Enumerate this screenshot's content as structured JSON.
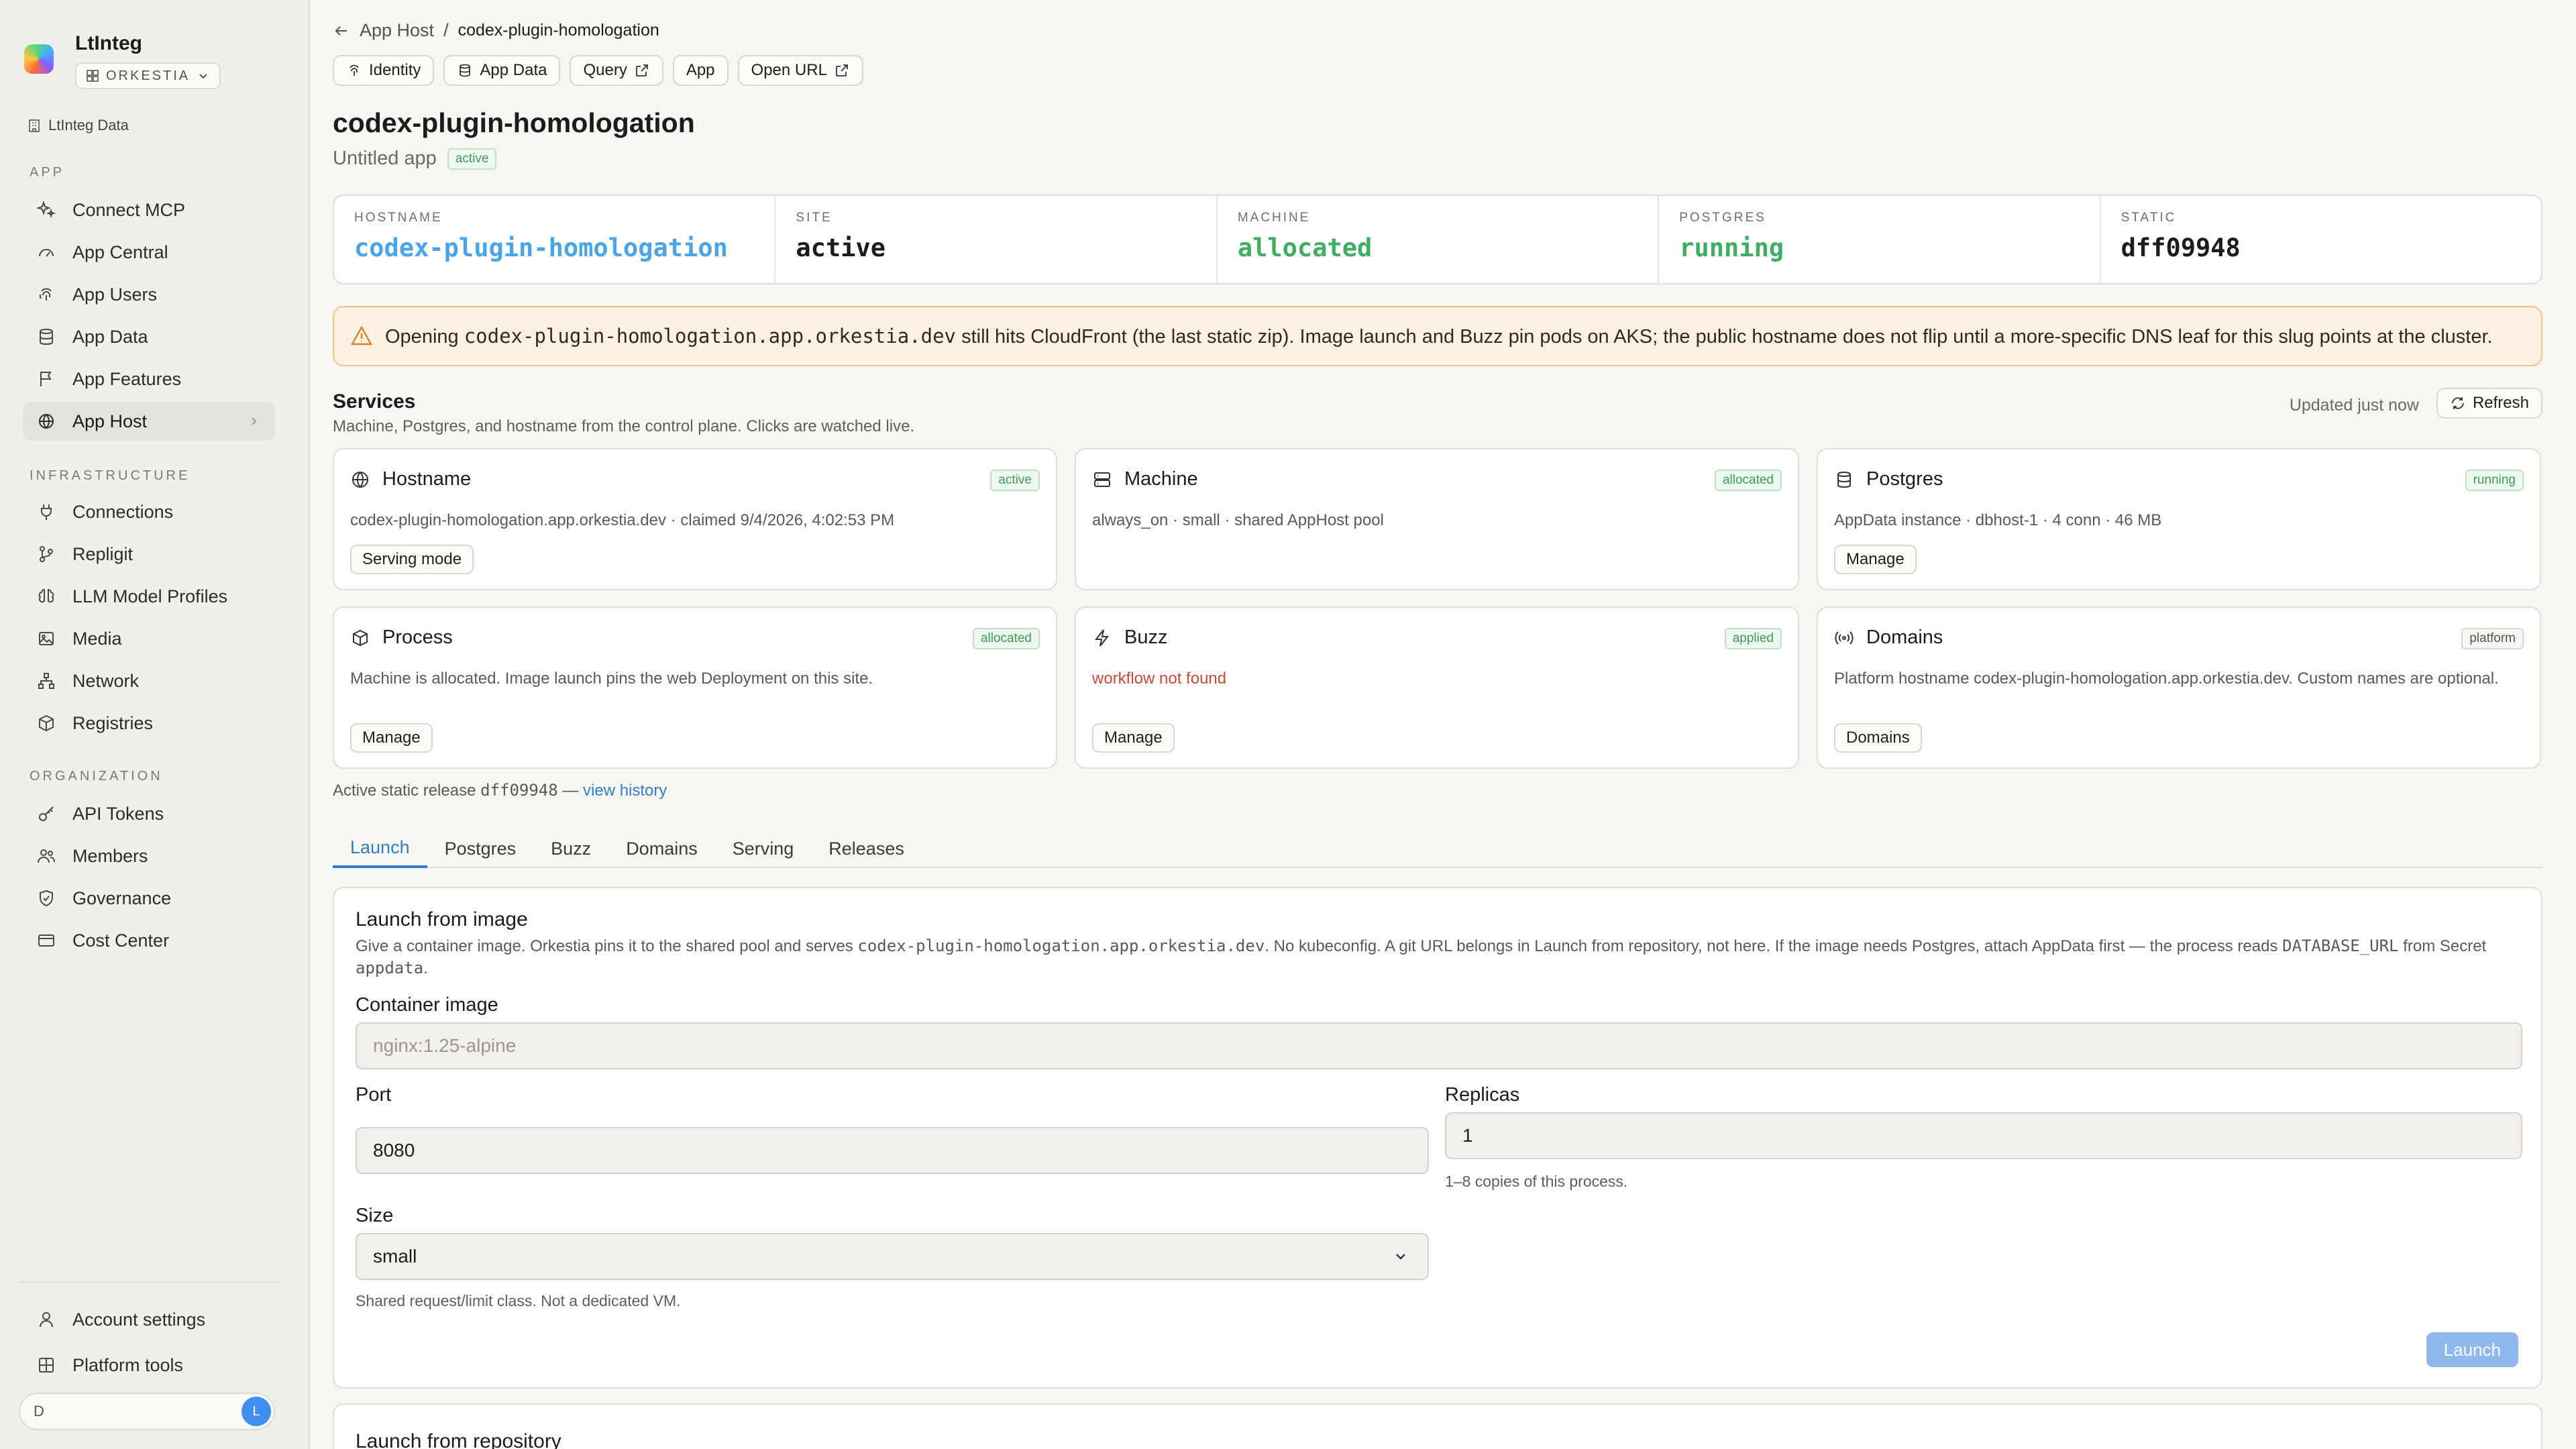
{
  "sidebar": {
    "brand": "LtInteg",
    "org": "ORKESTIA",
    "data_link": "LtInteg Data",
    "sections": {
      "app": "APP",
      "infrastructure": "INFRASTRUCTURE",
      "organization": "ORGANIZATION"
    },
    "app_items": [
      "Connect MCP",
      "App Central",
      "App Users",
      "App Data",
      "App Features",
      "App Host"
    ],
    "infra_items": [
      "Connections",
      "Repligit",
      "LLM Model Profiles",
      "Media",
      "Network",
      "Registries"
    ],
    "org_items": [
      "API Tokens",
      "Members",
      "Governance",
      "Cost Center"
    ],
    "footer": {
      "account": "Account settings",
      "platform": "Platform tools",
      "search_value": "D",
      "avatar": "L"
    }
  },
  "breadcrumb": {
    "parent": "App Host",
    "separator": "/",
    "current": "codex-plugin-homologation"
  },
  "toolbar": {
    "identity": "Identity",
    "app_data": "App Data",
    "query": "Query",
    "app": "App",
    "open_url": "Open URL"
  },
  "page": {
    "title": "codex-plugin-homologation",
    "subtitle": "Untitled app",
    "status": "active"
  },
  "stats": {
    "hostname_label": "HOSTNAME",
    "hostname_value": "codex-plugin-homologation",
    "site_label": "SITE",
    "site_value": "active",
    "machine_label": "MACHINE",
    "machine_value": "allocated",
    "postgres_label": "POSTGRES",
    "postgres_value": "running",
    "static_label": "STATIC",
    "static_value": "dff09948"
  },
  "warning": {
    "prefix": "Opening",
    "host": "codex-plugin-homologation.app.orkestia.dev",
    "suffix": "still hits CloudFront (the last static zip). Image launch and Buzz pin pods on AKS; the public hostname does not flip until a more-specific DNS leaf for this slug points at the cluster."
  },
  "services": {
    "title": "Services",
    "subtitle": "Machine, Postgres, and hostname from the control plane. Clicks are watched live.",
    "updated": "Updated just now",
    "refresh": "Refresh",
    "cards": {
      "hostname": {
        "title": "Hostname",
        "badge": "active",
        "desc": "codex-plugin-homologation.app.orkestia.dev · claimed 9/4/2026, 4:02:53 PM",
        "button": "Serving mode"
      },
      "machine": {
        "title": "Machine",
        "badge": "allocated",
        "desc": "always_on · small · shared AppHost pool"
      },
      "postgres": {
        "title": "Postgres",
        "badge": "running",
        "desc": "AppData instance · dbhost-1 · 4 conn · 46 MB",
        "button": "Manage"
      },
      "process": {
        "title": "Process",
        "badge": "allocated",
        "desc": "Machine is allocated. Image launch pins the web Deployment on this site.",
        "button": "Manage"
      },
      "buzz": {
        "title": "Buzz",
        "badge": "applied",
        "desc": "workflow not found",
        "button": "Manage"
      },
      "domains": {
        "title": "Domains",
        "badge": "platform",
        "desc": "Platform hostname codex-plugin-homologation.app.orkestia.dev. Custom names are optional.",
        "button": "Domains"
      }
    }
  },
  "release": {
    "prefix": "Active static release",
    "id": "dff09948",
    "dash": "—",
    "link": "view history"
  },
  "tabs": [
    "Launch",
    "Postgres",
    "Buzz",
    "Domains",
    "Serving",
    "Releases"
  ],
  "launch": {
    "title": "Launch from image",
    "desc_1": "Give a container image. Orkestia pins it to the shared pool and serves",
    "desc_host": "codex-plugin-homologation.app.orkestia.dev",
    "desc_2": ". No kubeconfig. A git URL belongs in Launch from repository, not here. If the image needs Postgres, attach AppData first — the process reads",
    "desc_env": "DATABASE_URL",
    "desc_3": "from Secret",
    "desc_secret": "appdata",
    "desc_4": ".",
    "image_label": "Container image",
    "image_placeholder": "nginx:1.25-alpine",
    "port_label": "Port",
    "port_value": "8080",
    "replicas_label": "Replicas",
    "replicas_value": "1",
    "replicas_hint": "1–8 copies of this process.",
    "size_label": "Size",
    "size_value": "small",
    "size_hint": "Shared request/limit class. Not a dedicated VM.",
    "button": "Launch"
  },
  "repo": {
    "title": "Launch from repository"
  },
  "colors": {
    "accent": "#2f7ec7",
    "status_green": "#3fae62",
    "hostname_blue": "#4aa5e8",
    "warn_bg": "#fdf0e2",
    "error": "#c84a3a"
  }
}
